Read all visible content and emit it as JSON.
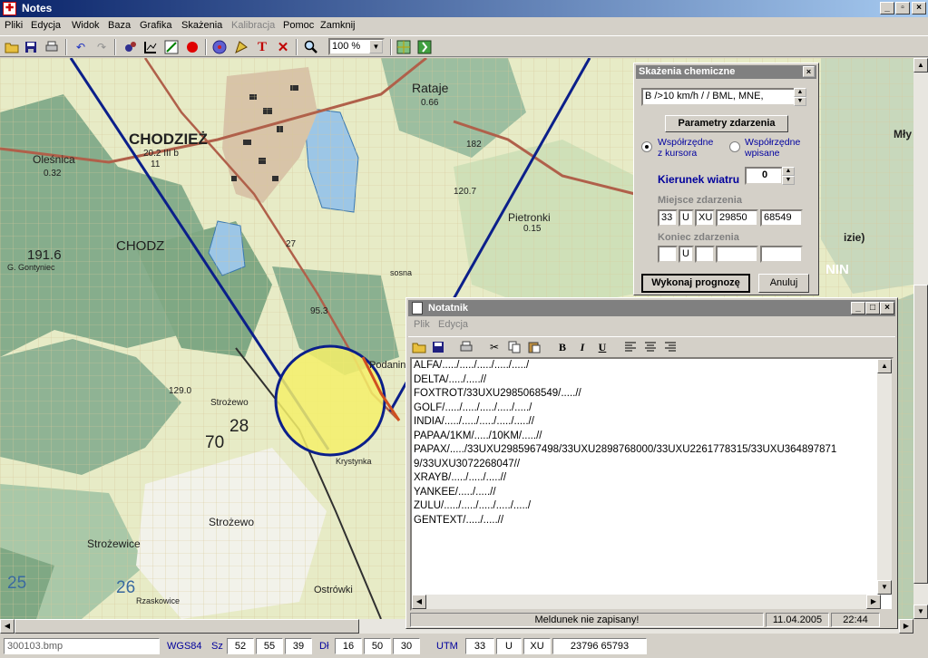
{
  "window": {
    "title": "Notes",
    "minimize": "_",
    "maximize": "▫",
    "close": "×"
  },
  "menu": [
    "Pliki",
    "Edycja",
    "Widok",
    "Baza",
    "Grafika",
    "Skażenia",
    "Kalibracja",
    "Pomoc",
    "Zamknij"
  ],
  "toolbar": {
    "zoom": "100 %"
  },
  "map": {
    "labels": {
      "chodziez": "CHODZIEŻ",
      "chodziez_num": "20.2 III b",
      "rataje": "Rataje",
      "rataje_num": "0.66",
      "olesnica": "Oleśnica",
      "olesnica_num": "0.32",
      "n191": "191.6",
      "gontyniec": "G. Gontyniec",
      "chodz": "CHODZ",
      "pietronki": "Pietronki",
      "pietronki_num": "0.15",
      "strozewo": "Strożewo",
      "strozewice": "Strożewice",
      "n28": "28",
      "n70": "70",
      "n26": "26",
      "n25": "25",
      "podanin": "Podanin",
      "krystynka": "Krystynka",
      "ostrowki": "Ostrówki",
      "rzaskowice": "Rzaskowice",
      "n120": "120.7",
      "n95": "95.3",
      "n129": "129.0",
      "n182": "182",
      "n11": "11",
      "nin": "NIN",
      "mly": "Mły",
      "izie": "izie)",
      "sosna": "sosna",
      "n27": "27"
    }
  },
  "panel": {
    "title": "Skażenia chemiczne",
    "agent": "B />10 km/h /  / BML, MNE,",
    "params_button": "Parametry zdarzenia",
    "radio_cursor": "Współrzędne\nz kursora",
    "radio_entered": "Współrzędne\nwpisane",
    "wind_label": "Kierunek wiatru",
    "wind_value": "0",
    "place_label": "Miejsce zdarzenia",
    "place": [
      "33",
      "U",
      "XU",
      "29850",
      "68549"
    ],
    "end_label": "Koniec zdarzenia",
    "end": [
      "",
      "U",
      "",
      "",
      ""
    ],
    "run_button": "Wykonaj prognozę",
    "cancel_button": "Anuluj"
  },
  "notes": {
    "title": "Notatnik",
    "menu": [
      "Plik",
      "Edycja"
    ],
    "lines": [
      "ALFA/...../...../...../...../...../",
      "DELTA/...../.....//",
      "FOXTROT/33UXU2985068549/.....//",
      "GOLF/...../...../...../...../...../",
      "INDIA/...../...../...../...../.....//",
      "PAPAA/1KM/...../10KM/.....//",
      "PAPAX/...../33UXU2985967498/33UXU2898768000/33UXU2261778315/33UXU364897871",
      "9/33UXU3072268047//",
      "XRAYB/...../...../.....//",
      "YANKEE/...../.....//",
      "ZULU/...../...../...../...../...../",
      "GENTEXT/...../.....//"
    ],
    "status": "Meldunek nie zapisany!",
    "date": "11.04.2005",
    "time": "22:44"
  },
  "statusbar": {
    "file": "300103.bmp",
    "datum": "WGS84",
    "sz_label": "Sz",
    "sz": [
      "52",
      "55",
      "39"
    ],
    "dl_label": "Dł",
    "dl": [
      "16",
      "50",
      "30"
    ],
    "utm_label": "UTM",
    "utm": [
      "33",
      "U",
      "XU",
      "23796  65793"
    ]
  },
  "colors": {
    "title_start": "#0a246a",
    "title_end": "#a6caf0",
    "map_bg": "#e6ebc4",
    "forest": "#7fa883",
    "line_blue": "#0b1f8a",
    "zone_fill": "#f4f06a"
  }
}
